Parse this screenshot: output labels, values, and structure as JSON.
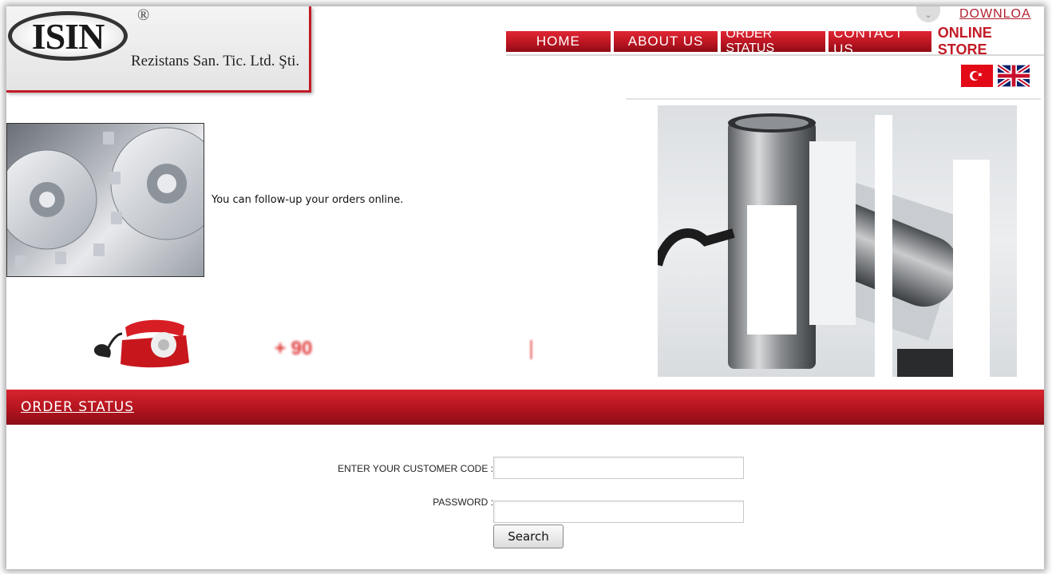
{
  "header": {
    "logo_text": "ISIN",
    "registered_mark": "®",
    "company_name": "Rezistans San. Tic. Ltd. Şti.",
    "download_label": "DOWNLOA"
  },
  "nav": {
    "items": [
      {
        "label": "HOME"
      },
      {
        "label": "ABOUT US"
      },
      {
        "label": "ORDER STATUS"
      },
      {
        "label": "CONTACT US"
      }
    ],
    "online_store": "ONLINE STORE",
    "colors": {
      "accent": "#c21b26",
      "flag_tr": "#e30a17"
    }
  },
  "languages": {
    "tr_icon": "turkey-flag-icon",
    "en_icon": "uk-flag-icon"
  },
  "intro": {
    "text": "You can follow-up your orders online."
  },
  "contact": {
    "phone_prefix": "+ 90"
  },
  "order_status": {
    "title": "ORDER STATUS",
    "customer_code_label": "ENTER YOUR CUSTOMER CODE :",
    "customer_code_value": "",
    "password_label": "PASSWORD :",
    "password_value": "",
    "search_button": "Search"
  }
}
